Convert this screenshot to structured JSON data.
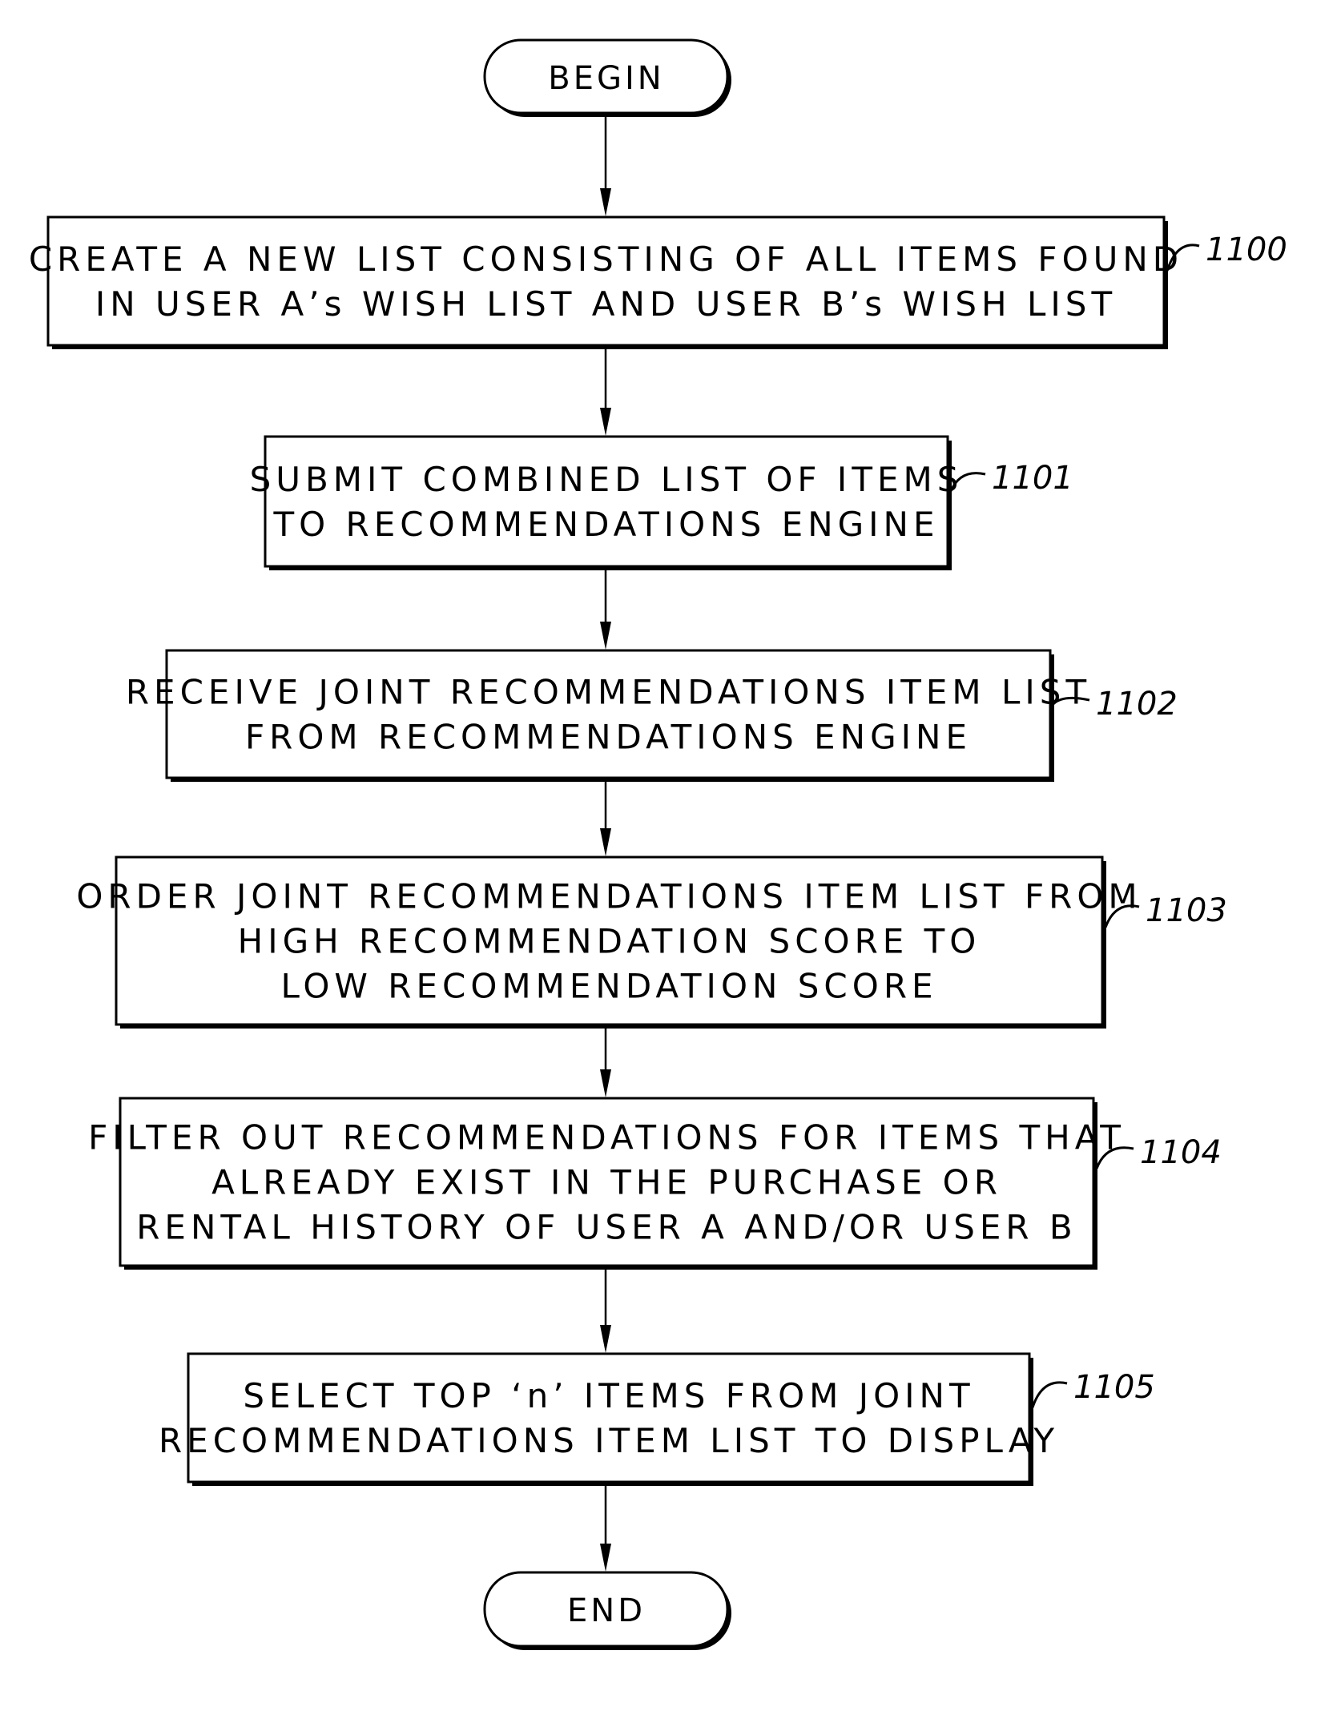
{
  "diagram": {
    "type": "flowchart",
    "start": {
      "label": "BEGIN"
    },
    "end": {
      "label": "END"
    },
    "steps": [
      {
        "ref": "1100",
        "lines": [
          "CREATE A NEW LIST CONSISTING OF ALL ITEMS FOUND",
          "IN USER A’s WISH LIST AND USER B’s WISH LIST"
        ]
      },
      {
        "ref": "1101",
        "lines": [
          "SUBMIT COMBINED LIST OF ITEMS",
          "TO RECOMMENDATIONS ENGINE"
        ]
      },
      {
        "ref": "1102",
        "lines": [
          "RECEIVE JOINT RECOMMENDATIONS ITEM LIST",
          "FROM RECOMMENDATIONS ENGINE"
        ]
      },
      {
        "ref": "1103",
        "lines": [
          "ORDER JOINT RECOMMENDATIONS ITEM LIST FROM",
          "HIGH RECOMMENDATION SCORE TO",
          "LOW RECOMMENDATION SCORE"
        ]
      },
      {
        "ref": "1104",
        "lines": [
          "FILTER OUT RECOMMENDATIONS FOR ITEMS THAT",
          "ALREADY EXIST IN THE PURCHASE OR",
          "RENTAL HISTORY OF USER A AND/OR USER B"
        ]
      },
      {
        "ref": "1105",
        "lines": [
          "SELECT TOP ‘n’ ITEMS FROM JOINT",
          "RECOMMENDATIONS ITEM LIST TO DISPLAY"
        ]
      }
    ],
    "edges": [
      [
        "BEGIN",
        "1100"
      ],
      [
        "1100",
        "1101"
      ],
      [
        "1101",
        "1102"
      ],
      [
        "1102",
        "1103"
      ],
      [
        "1103",
        "1104"
      ],
      [
        "1104",
        "1105"
      ],
      [
        "1105",
        "END"
      ]
    ]
  }
}
